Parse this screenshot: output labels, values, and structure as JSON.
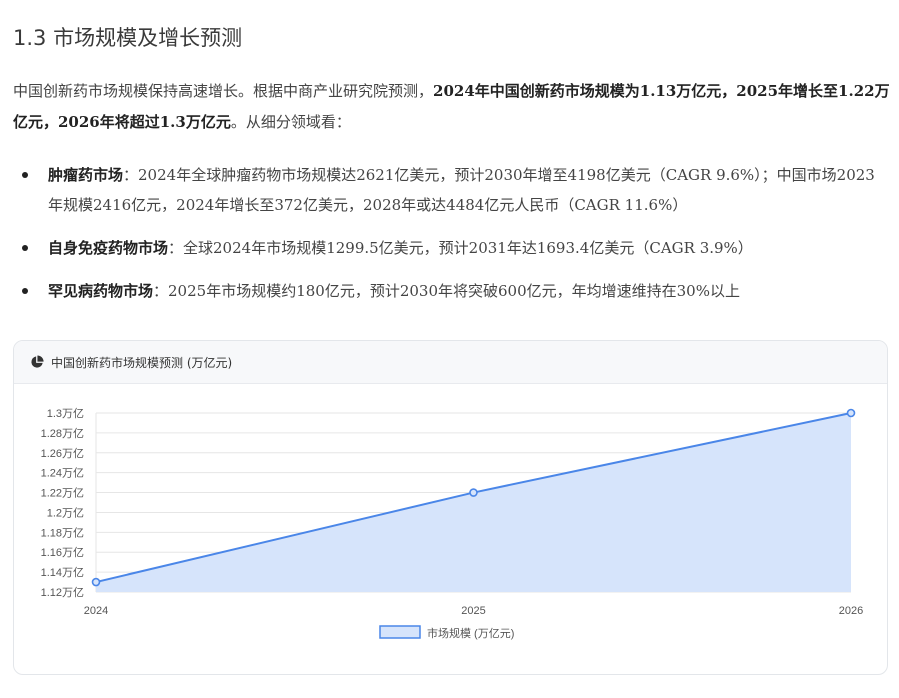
{
  "section": {
    "heading": "1.3 市场规模及增长预测"
  },
  "intro": {
    "text_1": "中国创新药市场规模保持高速增长。根据中商产业研究院预测，",
    "bold_1": "2024年中国创新药市场规模为1.13万亿元，2025年增长至1.22万亿元，2026年将超过1.3万亿元",
    "text_2": "。从细分领域看："
  },
  "bullets": [
    {
      "label": "肿瘤药市场",
      "text": "：2024年全球肿瘤药物市场规模达2621亿美元，预计2030年增至4198亿美元（CAGR 9.6%）；中国市场2023年规模2416亿元，2024年增长至372亿美元，2028年或达4484亿元人民币（CAGR 11.6%）"
    },
    {
      "label": "自身免疫药物市场",
      "text": "：全球2024年市场规模1299.5亿美元，预计2031年达1693.4亿美元（CAGR 3.9%）"
    },
    {
      "label": "罕见病药物市场",
      "text": "：2025年市场规模约180亿元，预计2030年将突破600亿元，年均增速维持在30%以上"
    }
  ],
  "card": {
    "title": "中国创新药市场规模预测 (万亿元)",
    "icon": "pie-chart-icon"
  },
  "chart_data": {
    "type": "area",
    "title": "中国创新药市场规模预测 (万亿元)",
    "categories": [
      "2024",
      "2025",
      "2026"
    ],
    "series": [
      {
        "name": "市场规模 (万亿元)",
        "values": [
          1.13,
          1.22,
          1.3
        ]
      }
    ],
    "ylim": [
      1.12,
      1.3
    ],
    "yticks": [
      1.3,
      1.28,
      1.26,
      1.24,
      1.22,
      1.2,
      1.18,
      1.16,
      1.14,
      1.12
    ],
    "ytick_suffix": "万亿",
    "grid": true,
    "legend": "bottom",
    "colors": {
      "line": "#4a86e8",
      "fill": "#d6e4fb",
      "grid": "#e6e6e6",
      "axis_text": "#555555"
    }
  }
}
